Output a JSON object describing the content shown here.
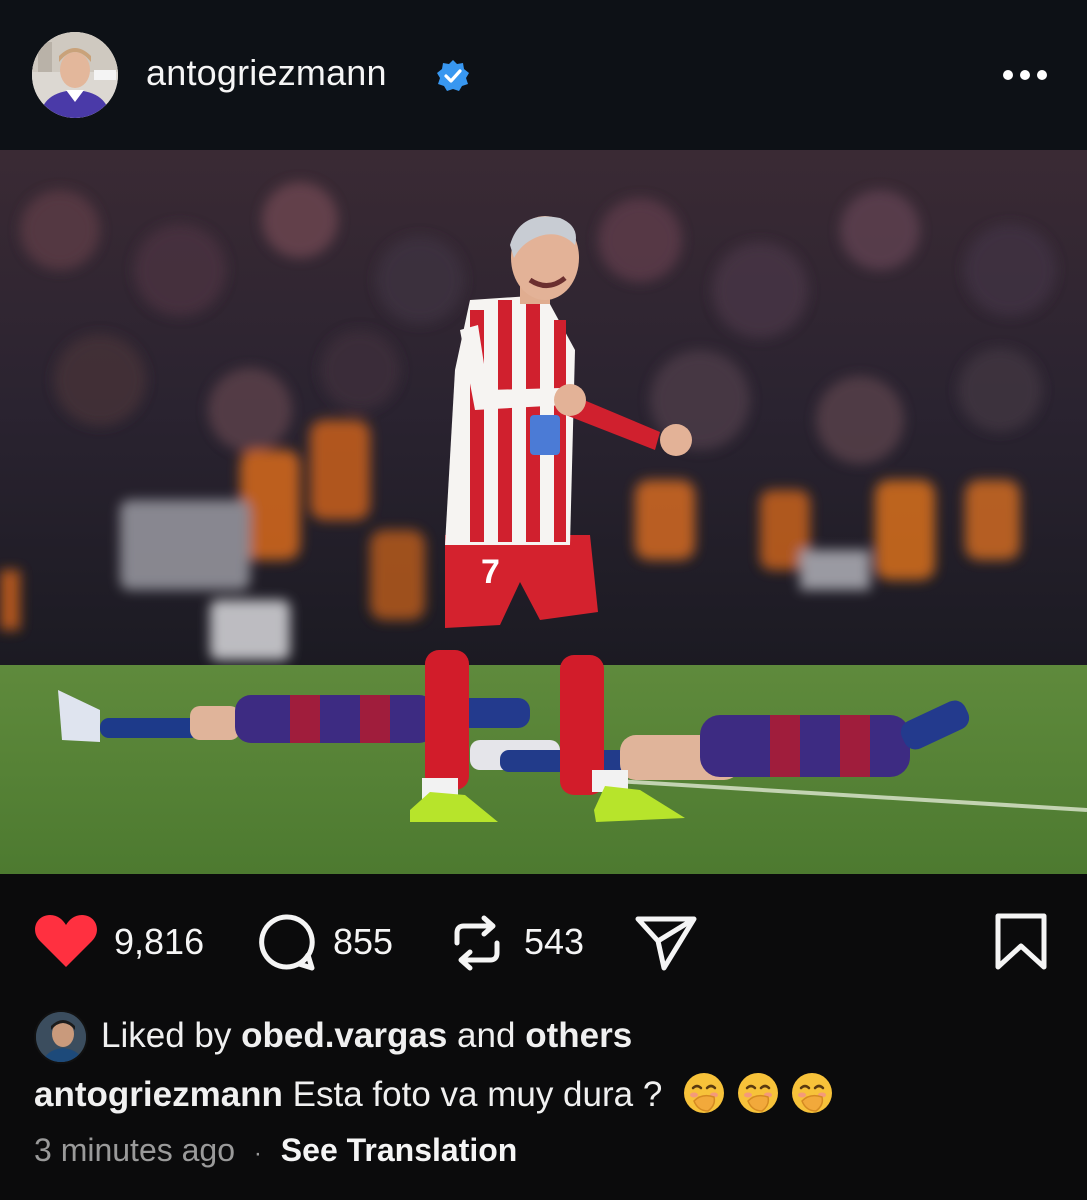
{
  "post": {
    "username": "antogriezmann",
    "more_icon": "ellipsis-horizontal-icon",
    "verified_icon": "verified-badge-icon",
    "verified_color": "#3897f0"
  },
  "photo": {
    "jersey_number": "7"
  },
  "actions": {
    "likes": "9,816",
    "comments": "855",
    "reposts": "543",
    "like_color": "#ff3040",
    "icons": [
      "heart-icon",
      "comment-icon",
      "repost-icon",
      "share-icon",
      "bookmark-icon"
    ]
  },
  "liked_by": {
    "prefix": "Liked by",
    "user": "obed.vargas",
    "connector": "and",
    "others": "others"
  },
  "caption": {
    "username": "antogriezmann",
    "text": "Esta foto va muy dura ?"
  },
  "meta": {
    "timestamp": "3 minutes ago",
    "separator": "·",
    "translate": "See Translation"
  }
}
